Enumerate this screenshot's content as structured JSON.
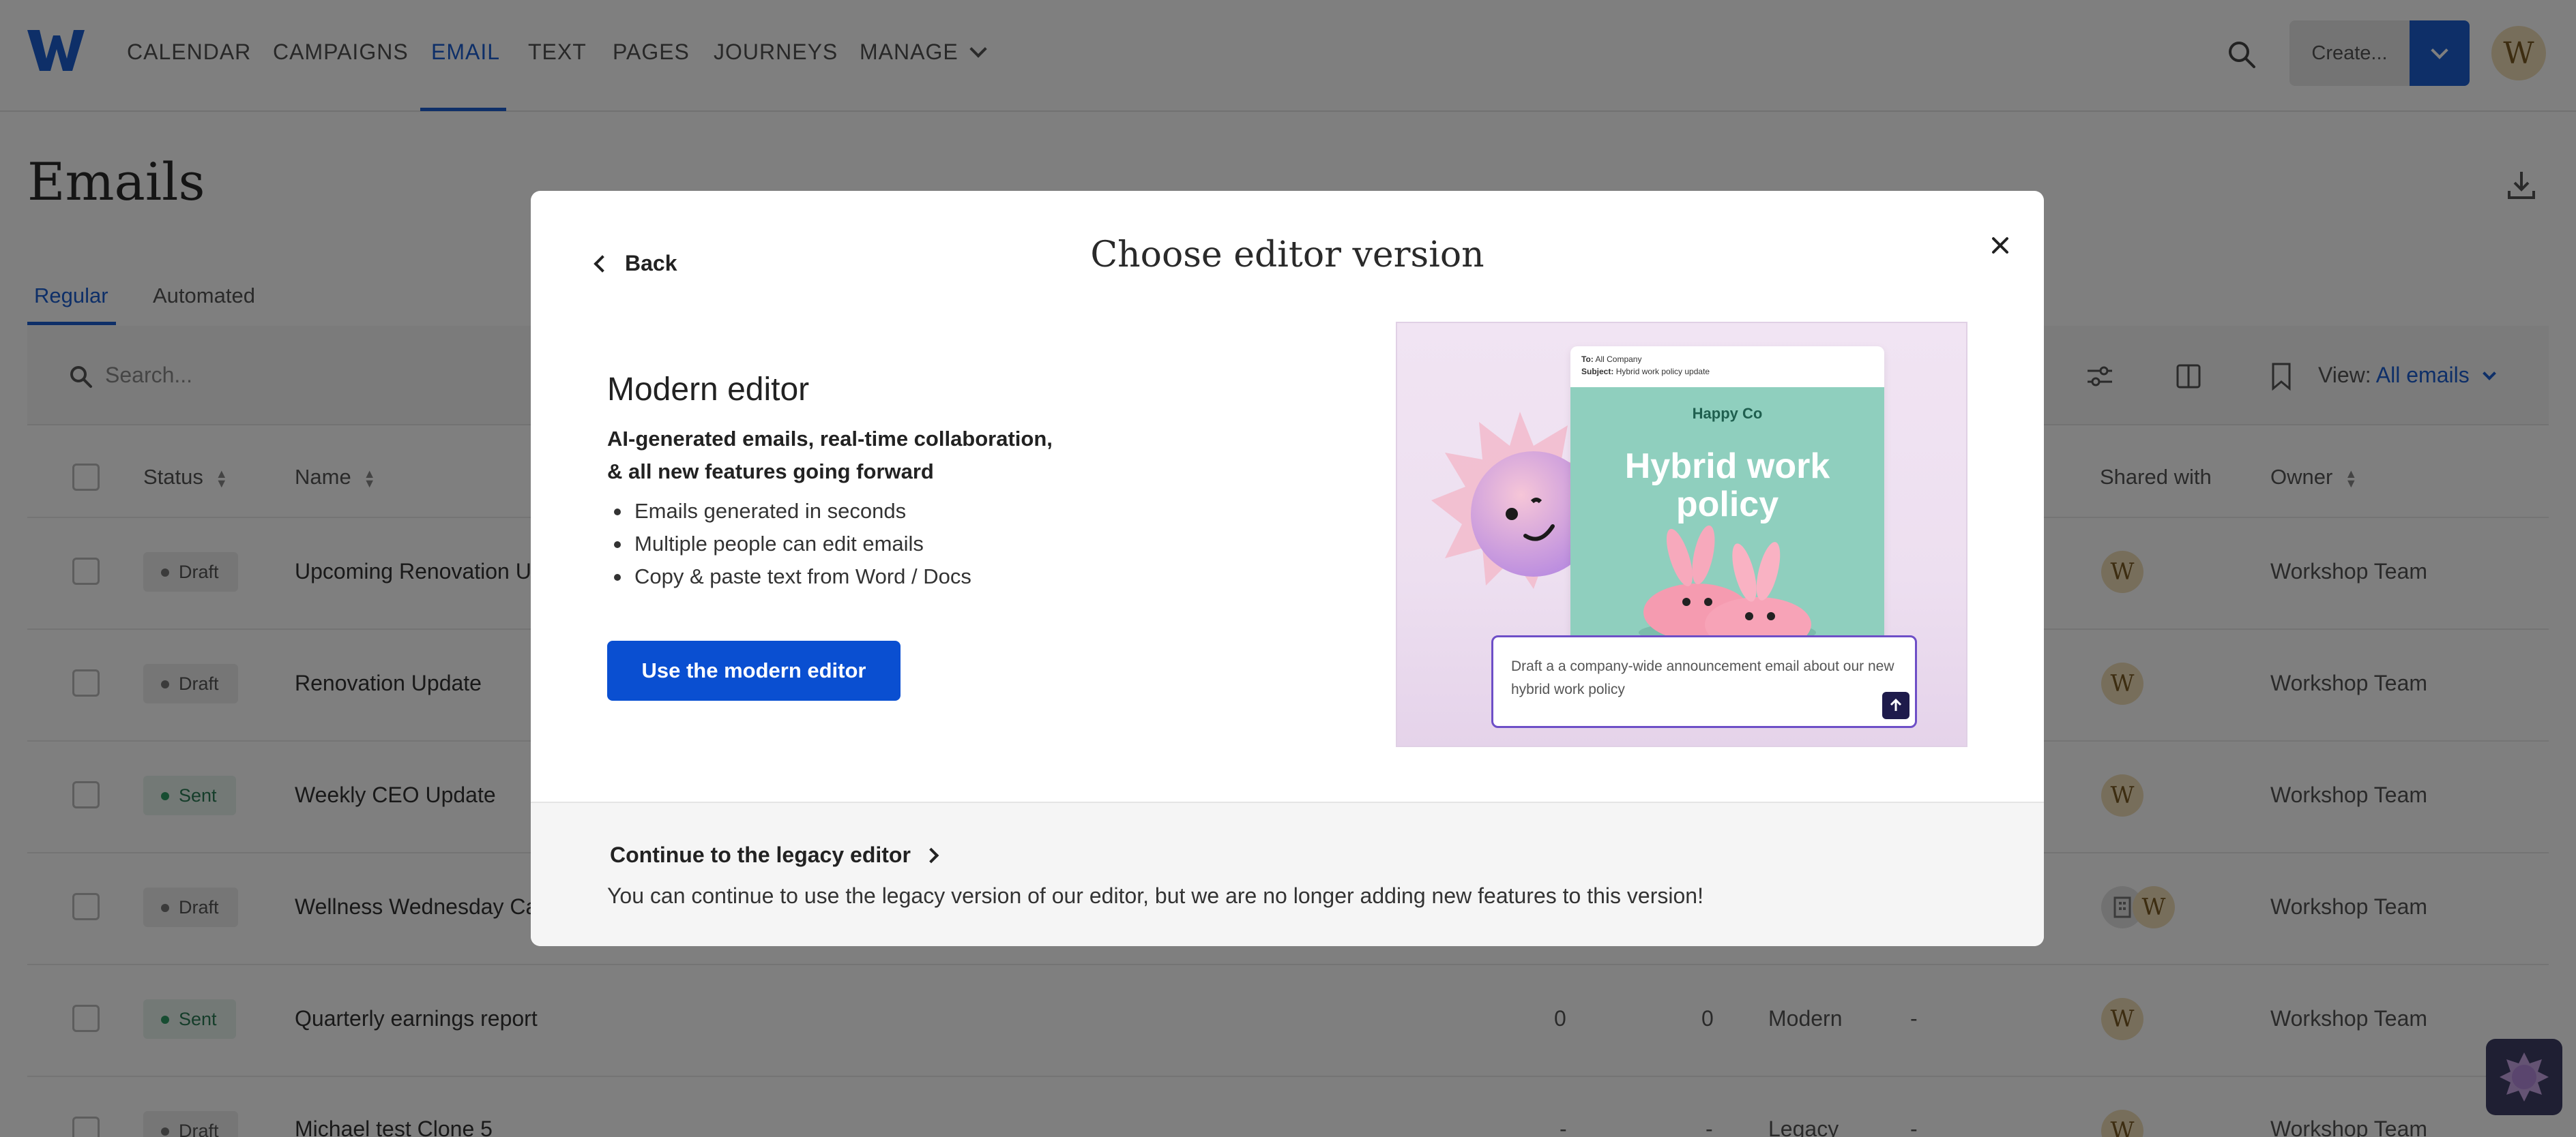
{
  "nav": {
    "items": [
      "CALENDAR",
      "CAMPAIGNS",
      "EMAIL",
      "TEXT",
      "PAGES",
      "JOURNEYS",
      "MANAGE"
    ],
    "active": "EMAIL",
    "create_label": "Create...",
    "avatar_initial": "W"
  },
  "page": {
    "title": "Emails",
    "tabs": [
      "Regular",
      "Automated"
    ],
    "search_placeholder": "Search...",
    "view_label": "View:",
    "view_value": "All emails"
  },
  "table": {
    "columns": {
      "status": "Status",
      "name": "Name",
      "shared_with": "Shared with",
      "owner": "Owner"
    },
    "rows": [
      {
        "status": "Draft",
        "name": "Upcoming Renovation U",
        "shared": "W",
        "owner": "Workshop Team"
      },
      {
        "status": "Draft",
        "name": "Renovation Update",
        "shared": "W",
        "owner": "Workshop Team"
      },
      {
        "status": "Sent",
        "name": "Weekly CEO Update",
        "shared": "W",
        "owner": "Workshop Team"
      },
      {
        "status": "Draft",
        "name": "Wellness Wednesday Ca",
        "shared": "W",
        "owner": "Workshop Team"
      },
      {
        "status": "Sent",
        "name": "Quarterly earnings report",
        "col_a": "0",
        "col_b": "0",
        "editor": "Modern",
        "dash": "-",
        "shared": "W",
        "owner": "Workshop Team"
      },
      {
        "status": "Draft",
        "name": "Michael test Clone 5",
        "col_a": "-",
        "col_b": "-",
        "editor": "Legacy",
        "dash": "-",
        "shared": "W",
        "owner": "Workshop Team"
      }
    ]
  },
  "modal": {
    "back_label": "Back",
    "title": "Choose editor version",
    "modern": {
      "heading": "Modern editor",
      "subtitle_line1": "AI-generated emails, real-time collaboration,",
      "subtitle_line2": "& all new features going forward",
      "bullets": [
        "Emails generated in seconds",
        "Multiple people can edit emails",
        "Copy & paste text from Word / Docs"
      ],
      "button_label": "Use the modern editor"
    },
    "preview": {
      "to_label": "To:",
      "to_value": "All Company",
      "subject_label": "Subject:",
      "subject_value": "Hybrid work policy update",
      "brand": "Happy Co",
      "headline_line1": "Hybrid work",
      "headline_line2": "policy",
      "prompt_text": "Draft a a company-wide announcement email about our new hybrid work policy"
    },
    "legacy": {
      "link_label": "Continue to the legacy editor",
      "description": "You can continue to use the legacy version of our editor, but we are no longer adding new features to this version!"
    }
  },
  "colors": {
    "accent": "#1c5fd1",
    "primary_button": "#0a4fd1",
    "overlay": "rgba(0,0,0,0.5)"
  }
}
